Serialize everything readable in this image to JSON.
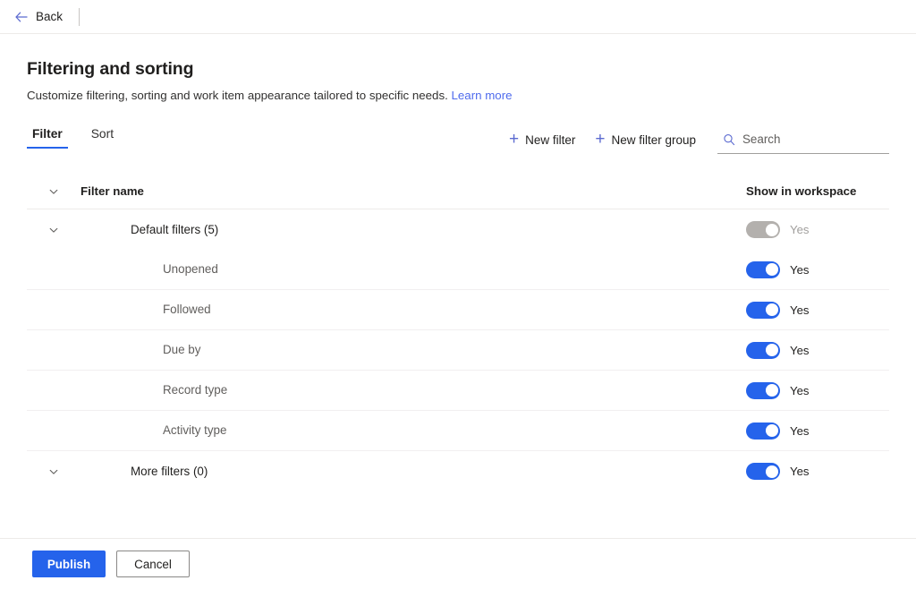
{
  "backbar": {
    "label": "Back",
    "arrow_icon": "arrow-left-icon"
  },
  "header": {
    "title": "Filtering and sorting",
    "subtitle": "Customize filtering, sorting and work item appearance tailored to specific needs.",
    "learn_more": "Learn more"
  },
  "tabs": [
    {
      "label": "Filter",
      "active": true
    },
    {
      "label": "Sort",
      "active": false
    }
  ],
  "actions": {
    "new_filter": "New filter",
    "new_filter_group": "New filter group",
    "plus_icon": "plus-icon"
  },
  "search": {
    "placeholder": "Search",
    "value": "",
    "icon": "search-icon"
  },
  "table": {
    "columns": {
      "name": "Filter name",
      "toggle": "Show in workspace"
    },
    "header_chevron": "chevron-down-icon",
    "rows": [
      {
        "name": "Default filters (5)",
        "type": "group",
        "indent": 0,
        "chevron": "chevron-down-icon",
        "toggle_on": true,
        "toggle_disabled": true,
        "toggle_label": "Yes",
        "divider": false
      },
      {
        "name": "Unopened",
        "type": "item",
        "indent": 1,
        "chevron": null,
        "toggle_on": true,
        "toggle_disabled": false,
        "toggle_label": "Yes",
        "divider": true
      },
      {
        "name": "Followed",
        "type": "item",
        "indent": 1,
        "chevron": null,
        "toggle_on": true,
        "toggle_disabled": false,
        "toggle_label": "Yes",
        "divider": true
      },
      {
        "name": "Due by",
        "type": "item",
        "indent": 1,
        "chevron": null,
        "toggle_on": true,
        "toggle_disabled": false,
        "toggle_label": "Yes",
        "divider": true
      },
      {
        "name": "Record type",
        "type": "item",
        "indent": 1,
        "chevron": null,
        "toggle_on": true,
        "toggle_disabled": false,
        "toggle_label": "Yes",
        "divider": true
      },
      {
        "name": "Activity type",
        "type": "item",
        "indent": 1,
        "chevron": null,
        "toggle_on": true,
        "toggle_disabled": false,
        "toggle_label": "Yes",
        "divider": true
      },
      {
        "name": "More filters (0)",
        "type": "group",
        "indent": 0,
        "chevron": "chevron-down-icon",
        "toggle_on": true,
        "toggle_disabled": false,
        "toggle_label": "Yes",
        "divider": false
      }
    ]
  },
  "footer": {
    "publish": "Publish",
    "cancel": "Cancel"
  },
  "colors": {
    "accent": "#2563eb",
    "link": "#4f6bed",
    "icon_blue": "#5b6ad0",
    "toggle_disabled": "#b3b0ad",
    "divider": "#edebe9"
  }
}
